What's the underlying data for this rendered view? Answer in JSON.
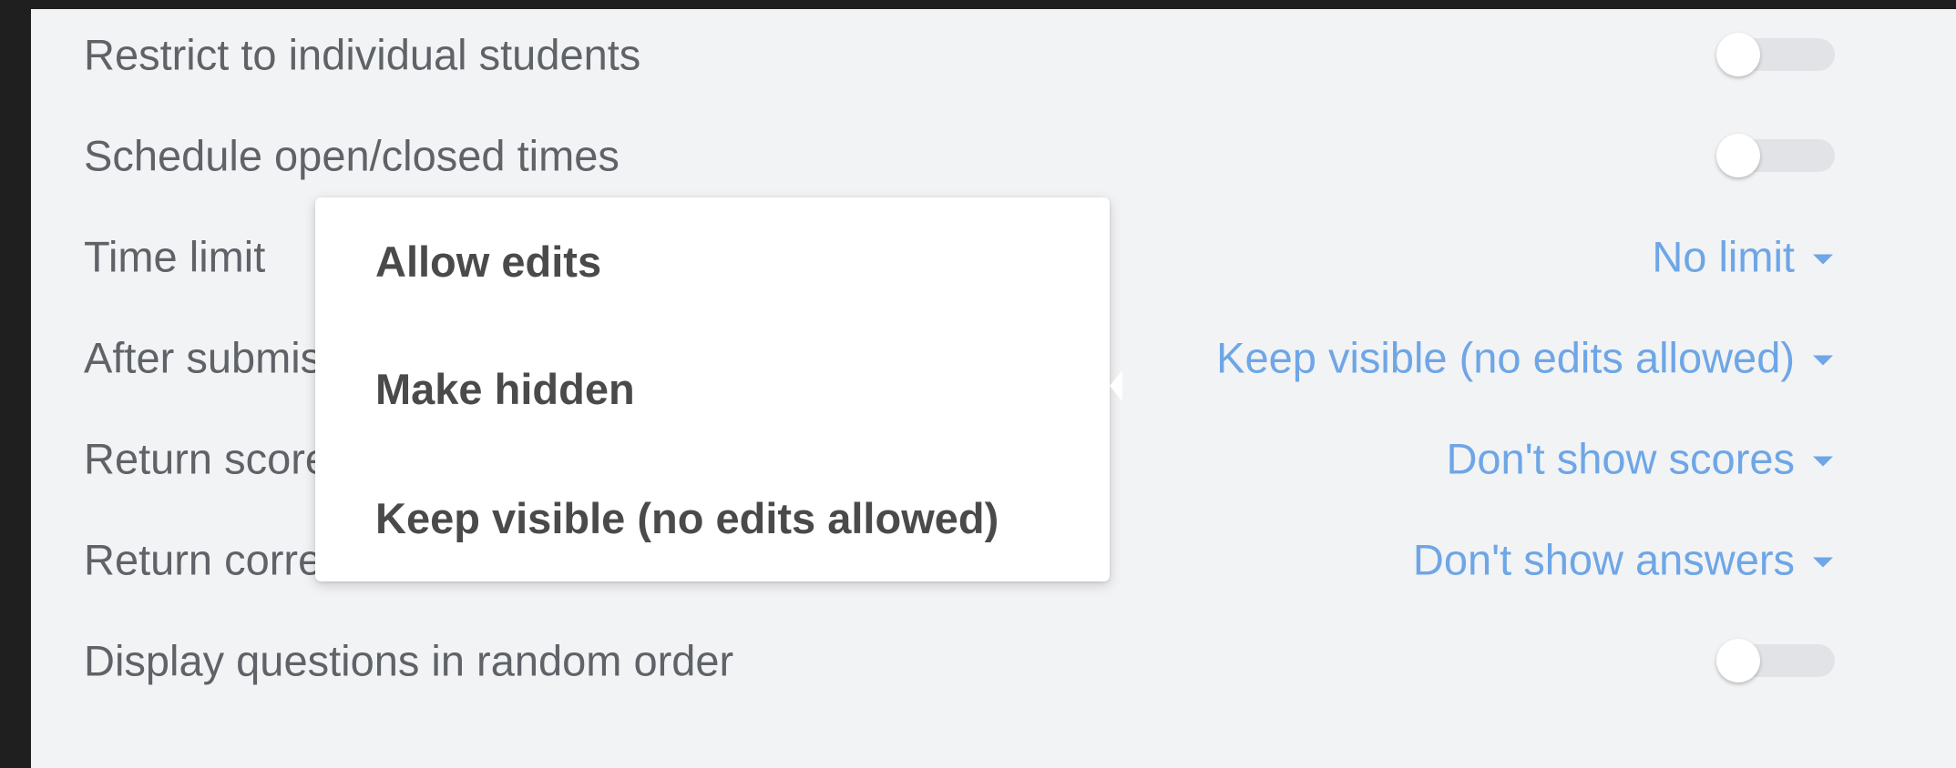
{
  "settings": {
    "restrict": {
      "label": "Restrict to individual students"
    },
    "schedule": {
      "label": "Schedule open/closed times"
    },
    "time_limit": {
      "label": "Time limit",
      "value": "No limit"
    },
    "after_submission": {
      "label": "After submission",
      "value": "Keep visible (no edits allowed)"
    },
    "return_scores": {
      "label": "Return scores",
      "value": "Don't show scores"
    },
    "return_answers": {
      "label": "Return correct answers",
      "value": "Don't show answers"
    },
    "random_order": {
      "label": "Display questions in random order"
    }
  },
  "toggles": {
    "restrict": false,
    "schedule": false,
    "random_order": false
  },
  "dropdown_menu": {
    "items": [
      {
        "label": "Allow edits"
      },
      {
        "label": "Make hidden"
      },
      {
        "label": "Keep visible (no edits allowed)"
      }
    ]
  },
  "colors": {
    "panel_background": "#f2f3f5",
    "label_text": "#5f6368",
    "select_accent": "#6ea6e6",
    "menu_background": "#ffffff"
  },
  "icons": {
    "caret": "caret-down-icon"
  }
}
